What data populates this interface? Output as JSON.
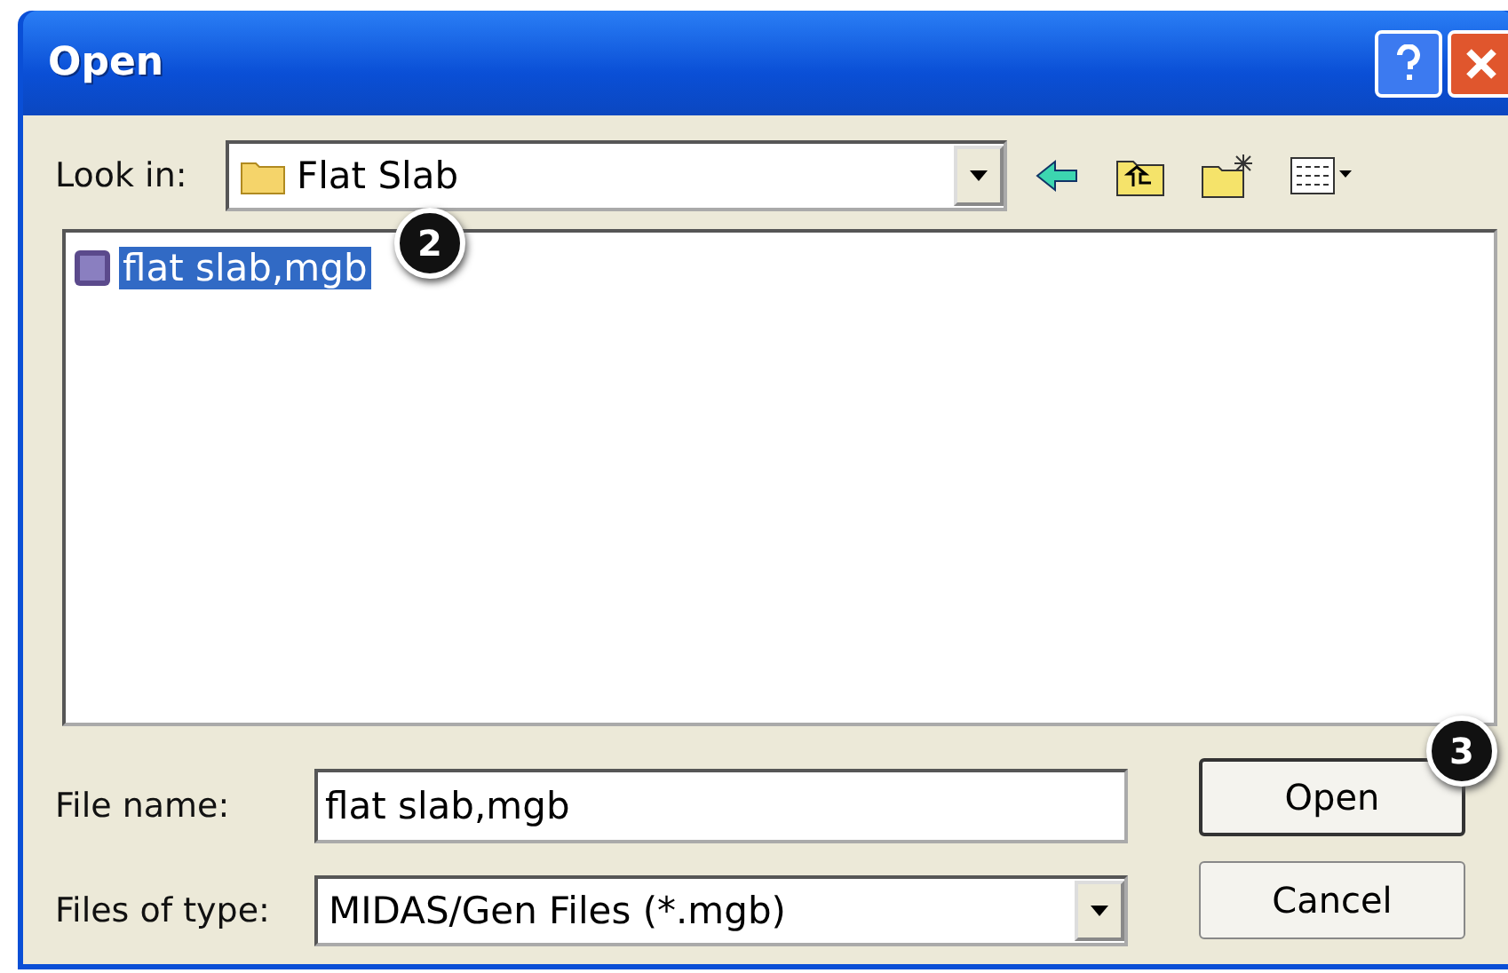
{
  "window": {
    "title": "Open"
  },
  "look_in": {
    "label": "Look in:",
    "value": "Flat Slab"
  },
  "files": [
    {
      "name": "flat slab,mgb",
      "selected": true
    }
  ],
  "callouts": [
    "2",
    "3"
  ],
  "file_name": {
    "label": "File name:",
    "value": "flat slab,mgb"
  },
  "file_type": {
    "label": "Files of type:",
    "value": "MIDAS/Gen Files (*.mgb)"
  },
  "buttons": [
    {
      "label": "Open",
      "default": true
    },
    {
      "label": "Cancel",
      "default": false
    }
  ]
}
